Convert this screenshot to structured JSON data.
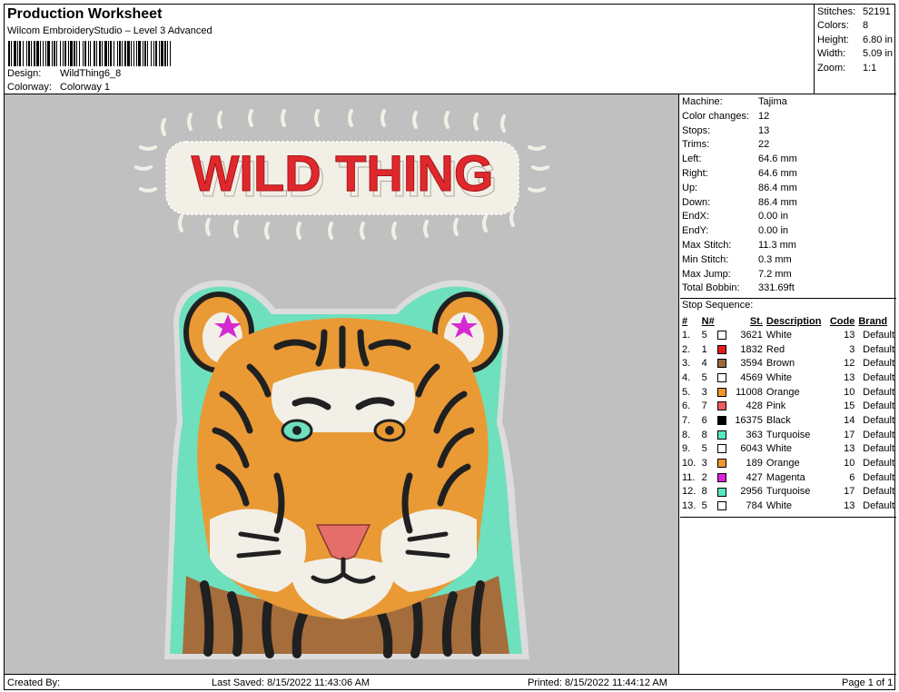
{
  "header": {
    "title": "Production Worksheet",
    "software": "Wilcom EmbroideryStudio – Level 3 Advanced",
    "design_label": "Design:",
    "design_value": "WildThing6_8",
    "colorway_label": "Colorway:",
    "colorway_value": "Colorway 1"
  },
  "summary": {
    "stitches_label": "Stitches:",
    "stitches_value": "52191",
    "colors_label": "Colors:",
    "colors_value": "8",
    "height_label": "Height:",
    "height_value": "6.80 in",
    "width_label": "Width:",
    "width_value": "5.09 in",
    "zoom_label": "Zoom:",
    "zoom_value": "1:1"
  },
  "design": {
    "banner_text": "WILD THING",
    "colors": {
      "background": "#c0c0c0",
      "banner_red": "#e0282c",
      "orange": "#e99a35",
      "black": "#202020",
      "white": "#f1efe6",
      "turquoise": "#6ee0bd",
      "pink": "#e66e6a",
      "magenta": "#d62ad1",
      "brown": "#a56d3c"
    }
  },
  "machine": {
    "rows": [
      {
        "label": "Machine:",
        "value": "Tajima"
      },
      {
        "label": "Color changes:",
        "value": "12"
      },
      {
        "label": "Stops:",
        "value": "13"
      },
      {
        "label": "Trims:",
        "value": "22"
      },
      {
        "label": "Left:",
        "value": "64.6 mm"
      },
      {
        "label": "Right:",
        "value": "64.6 mm"
      },
      {
        "label": "Up:",
        "value": "86.4 mm"
      },
      {
        "label": "Down:",
        "value": "86.4 mm"
      },
      {
        "label": "EndX:",
        "value": "0.00 in"
      },
      {
        "label": "EndY:",
        "value": "0.00 in"
      },
      {
        "label": "Max Stitch:",
        "value": "11.3 mm"
      },
      {
        "label": "Min Stitch:",
        "value": "0.3 mm"
      },
      {
        "label": "Max Jump:",
        "value": "7.2 mm"
      },
      {
        "label": "Total Bobbin:",
        "value": "331.69ft"
      }
    ]
  },
  "stop_sequence": {
    "label": "Stop Sequence:",
    "headers": {
      "idx": "#",
      "n": "N#",
      "st": "St.",
      "desc": "Description",
      "code": "Code",
      "brand": "Brand"
    },
    "rows": [
      {
        "idx": "1.",
        "n": "5",
        "color": "#ffffff",
        "st": "3621",
        "desc": "White",
        "code": "13",
        "brand": "Default"
      },
      {
        "idx": "2.",
        "n": "1",
        "color": "#e31b1b",
        "st": "1832",
        "desc": "Red",
        "code": "3",
        "brand": "Default"
      },
      {
        "idx": "3.",
        "n": "4",
        "color": "#9c6a3b",
        "st": "3594",
        "desc": "Brown",
        "code": "12",
        "brand": "Default"
      },
      {
        "idx": "4.",
        "n": "5",
        "color": "#ffffff",
        "st": "4569",
        "desc": "White",
        "code": "13",
        "brand": "Default"
      },
      {
        "idx": "5.",
        "n": "3",
        "color": "#f0952e",
        "st": "11008",
        "desc": "Orange",
        "code": "10",
        "brand": "Default"
      },
      {
        "idx": "6.",
        "n": "7",
        "color": "#ee5c5c",
        "st": "428",
        "desc": "Pink",
        "code": "15",
        "brand": "Default"
      },
      {
        "idx": "7.",
        "n": "6",
        "color": "#000000",
        "st": "16375",
        "desc": "Black",
        "code": "14",
        "brand": "Default"
      },
      {
        "idx": "8.",
        "n": "8",
        "color": "#58e6c4",
        "st": "363",
        "desc": "Turquoise",
        "code": "17",
        "brand": "Default"
      },
      {
        "idx": "9.",
        "n": "5",
        "color": "#ffffff",
        "st": "6043",
        "desc": "White",
        "code": "13",
        "brand": "Default"
      },
      {
        "idx": "10.",
        "n": "3",
        "color": "#f0952e",
        "st": "189",
        "desc": "Orange",
        "code": "10",
        "brand": "Default"
      },
      {
        "idx": "11.",
        "n": "2",
        "color": "#e020e0",
        "st": "427",
        "desc": "Magenta",
        "code": "6",
        "brand": "Default"
      },
      {
        "idx": "12.",
        "n": "8",
        "color": "#58e6c4",
        "st": "2956",
        "desc": "Turquoise",
        "code": "17",
        "brand": "Default"
      },
      {
        "idx": "13.",
        "n": "5",
        "color": "#ffffff",
        "st": "784",
        "desc": "White",
        "code": "13",
        "brand": "Default"
      }
    ]
  },
  "footer": {
    "created_by": "Created By:",
    "last_saved": "Last Saved: 8/15/2022 11:43:06 AM",
    "printed": "Printed: 8/15/2022 11:44:12 AM",
    "page": "Page 1 of 1"
  }
}
